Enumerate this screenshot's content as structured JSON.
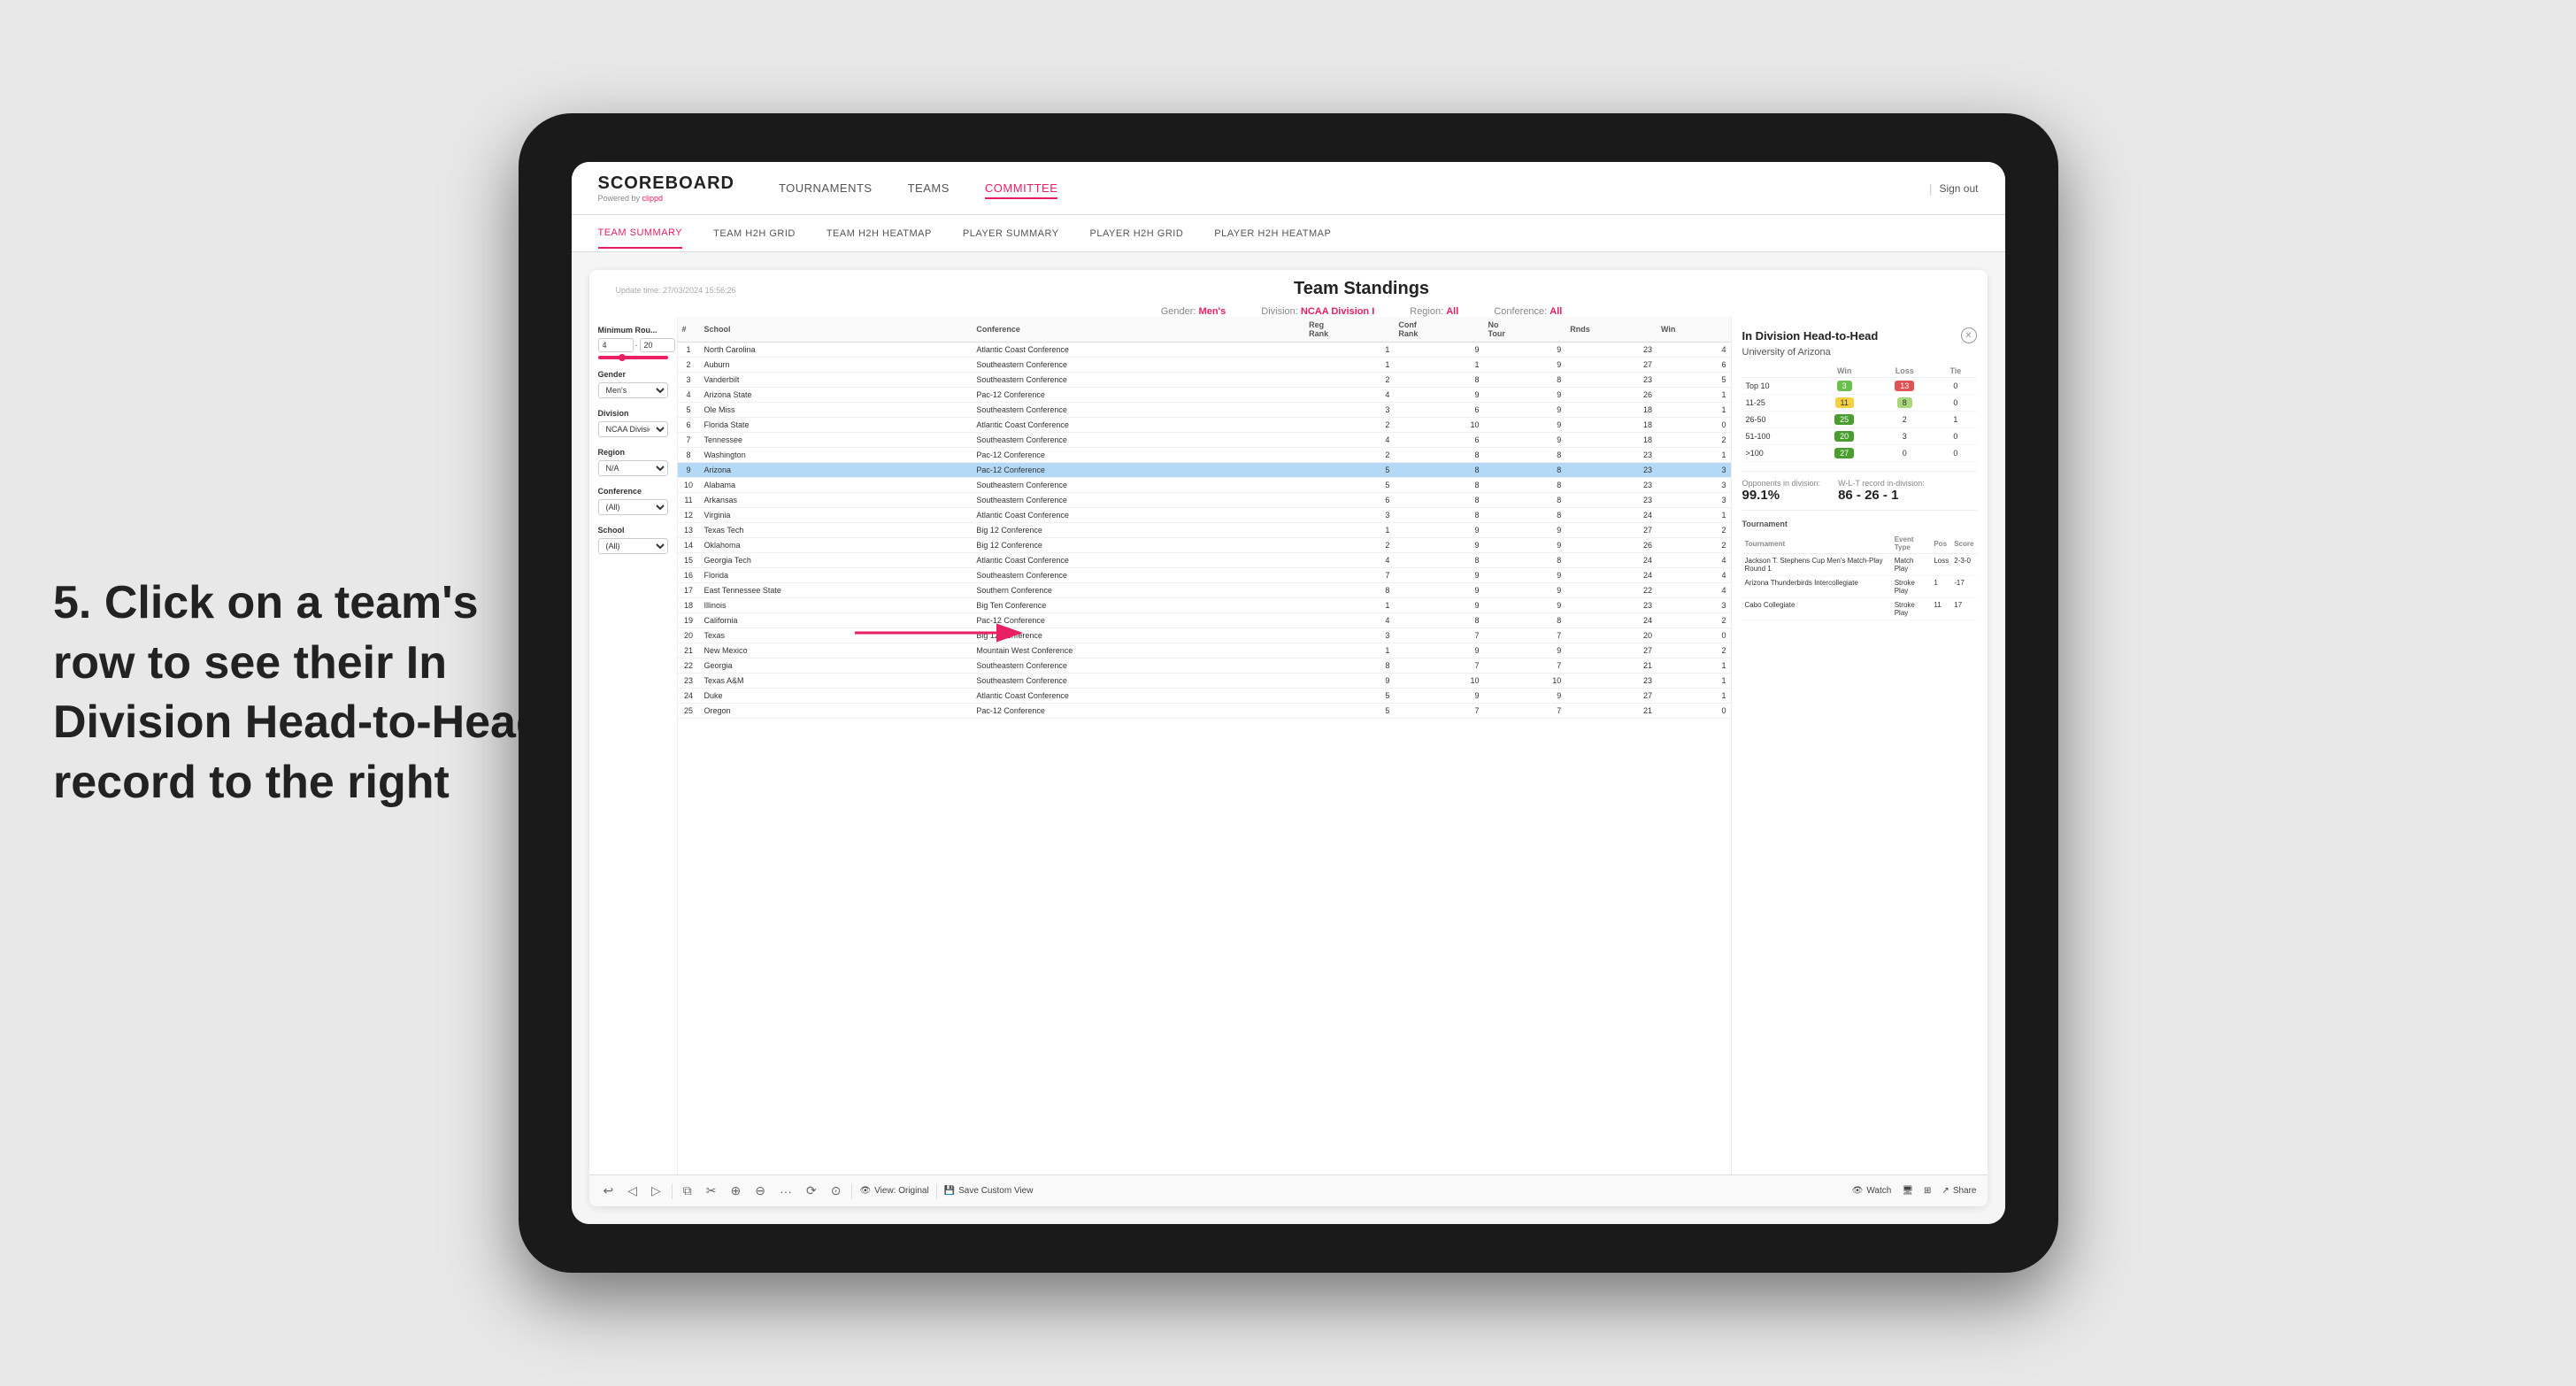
{
  "page": {
    "background": "#e8e8e8"
  },
  "annotation": {
    "text": "5. Click on a team's row to see their In Division Head-to-Head record to the right"
  },
  "top_nav": {
    "logo": "SCOREBOARD",
    "logo_sub": "Powered by clippd",
    "links": [
      {
        "label": "TOURNAMENTS",
        "active": false
      },
      {
        "label": "TEAMS",
        "active": false
      },
      {
        "label": "COMMITTEE",
        "active": true
      }
    ],
    "sign_out": "Sign out"
  },
  "sub_nav": {
    "links": [
      {
        "label": "TEAM SUMMARY",
        "active": true
      },
      {
        "label": "TEAM H2H GRID",
        "active": false
      },
      {
        "label": "TEAM H2H HEATMAP",
        "active": false
      },
      {
        "label": "PLAYER SUMMARY",
        "active": false
      },
      {
        "label": "PLAYER H2H GRID",
        "active": false
      },
      {
        "label": "PLAYER H2H HEATMAP",
        "active": false
      }
    ]
  },
  "panel": {
    "update_time": "Update time: 27/03/2024 15:56:26",
    "title": "Team Standings",
    "filters": {
      "gender_label": "Gender:",
      "gender_value": "Men's",
      "division_label": "Division:",
      "division_value": "NCAA Division I",
      "region_label": "Region:",
      "region_value": "All",
      "conference_label": "Conference:",
      "conference_value": "All"
    }
  },
  "sidebar_filters": {
    "min_rounds_label": "Minimum Rou...",
    "min_rounds_value": "4",
    "min_rounds_max": "20",
    "gender_label": "Gender",
    "gender_value": "Men's",
    "division_label": "Division",
    "division_value": "NCAA Division I",
    "region_label": "Region",
    "region_value": "N/A",
    "conference_label": "Conference",
    "conference_value": "(All)",
    "school_label": "School",
    "school_value": "(All)"
  },
  "table": {
    "headers": [
      "#",
      "School",
      "Conference",
      "Reg Rank",
      "Conf Rank",
      "No Tour",
      "Rnds",
      "Win"
    ],
    "rows": [
      {
        "rank": 1,
        "school": "North Carolina",
        "conference": "Atlantic Coast Conference",
        "reg_rank": 1,
        "conf_rank": 9,
        "no_tour": 9,
        "rnds": 23,
        "win": 4,
        "highlighted": false
      },
      {
        "rank": 2,
        "school": "Auburn",
        "conference": "Southeastern Conference",
        "reg_rank": 1,
        "conf_rank": 1,
        "no_tour": 9,
        "rnds": 27,
        "win": 6,
        "highlighted": false
      },
      {
        "rank": 3,
        "school": "Vanderbilt",
        "conference": "Southeastern Conference",
        "reg_rank": 2,
        "conf_rank": 8,
        "no_tour": 8,
        "rnds": 23,
        "win": 5,
        "highlighted": false
      },
      {
        "rank": 4,
        "school": "Arizona State",
        "conference": "Pac-12 Conference",
        "reg_rank": 4,
        "conf_rank": 9,
        "no_tour": 9,
        "rnds": 26,
        "win": 1,
        "highlighted": false
      },
      {
        "rank": 5,
        "school": "Ole Miss",
        "conference": "Southeastern Conference",
        "reg_rank": 3,
        "conf_rank": 6,
        "no_tour": 9,
        "rnds": 18,
        "win": 1,
        "highlighted": false
      },
      {
        "rank": 6,
        "school": "Florida State",
        "conference": "Atlantic Coast Conference",
        "reg_rank": 2,
        "conf_rank": 10,
        "no_tour": 9,
        "rnds": 18,
        "win": 0,
        "highlighted": false
      },
      {
        "rank": 7,
        "school": "Tennessee",
        "conference": "Southeastern Conference",
        "reg_rank": 4,
        "conf_rank": 6,
        "no_tour": 9,
        "rnds": 18,
        "win": 2,
        "highlighted": false
      },
      {
        "rank": 8,
        "school": "Washington",
        "conference": "Pac-12 Conference",
        "reg_rank": 2,
        "conf_rank": 8,
        "no_tour": 8,
        "rnds": 23,
        "win": 1,
        "highlighted": false
      },
      {
        "rank": 9,
        "school": "Arizona",
        "conference": "Pac-12 Conference",
        "reg_rank": 5,
        "conf_rank": 8,
        "no_tour": 8,
        "rnds": 23,
        "win": 3,
        "highlighted": true
      },
      {
        "rank": 10,
        "school": "Alabama",
        "conference": "Southeastern Conference",
        "reg_rank": 5,
        "conf_rank": 8,
        "no_tour": 8,
        "rnds": 23,
        "win": 3,
        "highlighted": false
      },
      {
        "rank": 11,
        "school": "Arkansas",
        "conference": "Southeastern Conference",
        "reg_rank": 6,
        "conf_rank": 8,
        "no_tour": 8,
        "rnds": 23,
        "win": 3,
        "highlighted": false
      },
      {
        "rank": 12,
        "school": "Virginia",
        "conference": "Atlantic Coast Conference",
        "reg_rank": 3,
        "conf_rank": 8,
        "no_tour": 8,
        "rnds": 24,
        "win": 1,
        "highlighted": false
      },
      {
        "rank": 13,
        "school": "Texas Tech",
        "conference": "Big 12 Conference",
        "reg_rank": 1,
        "conf_rank": 9,
        "no_tour": 9,
        "rnds": 27,
        "win": 2,
        "highlighted": false
      },
      {
        "rank": 14,
        "school": "Oklahoma",
        "conference": "Big 12 Conference",
        "reg_rank": 2,
        "conf_rank": 9,
        "no_tour": 9,
        "rnds": 26,
        "win": 2,
        "highlighted": false
      },
      {
        "rank": 15,
        "school": "Georgia Tech",
        "conference": "Atlantic Coast Conference",
        "reg_rank": 4,
        "conf_rank": 8,
        "no_tour": 8,
        "rnds": 24,
        "win": 4,
        "highlighted": false
      },
      {
        "rank": 16,
        "school": "Florida",
        "conference": "Southeastern Conference",
        "reg_rank": 7,
        "conf_rank": 9,
        "no_tour": 9,
        "rnds": 24,
        "win": 4,
        "highlighted": false
      },
      {
        "rank": 17,
        "school": "East Tennessee State",
        "conference": "Southern Conference",
        "reg_rank": 8,
        "conf_rank": 9,
        "no_tour": 9,
        "rnds": 22,
        "win": 4,
        "highlighted": false
      },
      {
        "rank": 18,
        "school": "Illinois",
        "conference": "Big Ten Conference",
        "reg_rank": 1,
        "conf_rank": 9,
        "no_tour": 9,
        "rnds": 23,
        "win": 3,
        "highlighted": false
      },
      {
        "rank": 19,
        "school": "California",
        "conference": "Pac-12 Conference",
        "reg_rank": 4,
        "conf_rank": 8,
        "no_tour": 8,
        "rnds": 24,
        "win": 2,
        "highlighted": false
      },
      {
        "rank": 20,
        "school": "Texas",
        "conference": "Big 12 Conference",
        "reg_rank": 3,
        "conf_rank": 7,
        "no_tour": 7,
        "rnds": 20,
        "win": 0,
        "highlighted": false
      },
      {
        "rank": 21,
        "school": "New Mexico",
        "conference": "Mountain West Conference",
        "reg_rank": 1,
        "conf_rank": 9,
        "no_tour": 9,
        "rnds": 27,
        "win": 2,
        "highlighted": false
      },
      {
        "rank": 22,
        "school": "Georgia",
        "conference": "Southeastern Conference",
        "reg_rank": 8,
        "conf_rank": 7,
        "no_tour": 7,
        "rnds": 21,
        "win": 1,
        "highlighted": false
      },
      {
        "rank": 23,
        "school": "Texas A&M",
        "conference": "Southeastern Conference",
        "reg_rank": 9,
        "conf_rank": 10,
        "no_tour": 10,
        "rnds": 23,
        "win": 1,
        "highlighted": false
      },
      {
        "rank": 24,
        "school": "Duke",
        "conference": "Atlantic Coast Conference",
        "reg_rank": 5,
        "conf_rank": 9,
        "no_tour": 9,
        "rnds": 27,
        "win": 1,
        "highlighted": false
      },
      {
        "rank": 25,
        "school": "Oregon",
        "conference": "Pac-12 Conference",
        "reg_rank": 5,
        "conf_rank": 7,
        "no_tour": 7,
        "rnds": 21,
        "win": 0,
        "highlighted": false
      }
    ]
  },
  "h2h_panel": {
    "title": "In Division Head-to-Head",
    "subtitle": "University of Arizona",
    "table_headers": [
      "",
      "Win",
      "Loss",
      "Tie"
    ],
    "rows": [
      {
        "range": "Top 10",
        "win": 3,
        "loss": 13,
        "tie": 0,
        "win_color": "green",
        "loss_color": "red",
        "tie_color": "none"
      },
      {
        "range": "11-25",
        "win": 11,
        "loss": 8,
        "tie": 0,
        "win_color": "yellow",
        "loss_color": "light-green",
        "tie_color": "none"
      },
      {
        "range": "26-50",
        "win": 25,
        "loss": 2,
        "tie": 1,
        "win_color": "dark-green",
        "loss_color": "none",
        "tie_color": "none"
      },
      {
        "range": "51-100",
        "win": 20,
        "loss": 3,
        "tie": 0,
        "win_color": "dark-green",
        "loss_color": "none",
        "tie_color": "none"
      },
      {
        "range": ">100",
        "win": 27,
        "loss": 0,
        "tie": 0,
        "win_color": "dark-green",
        "loss_color": "none",
        "tie_color": "none"
      }
    ],
    "opponents_label": "Opponents in division:",
    "opponents_value": "99.1%",
    "record_label": "W-L-T record in-division:",
    "record_value": "86 - 26 - 1",
    "tournament_label": "Tournament",
    "tournament_headers": [
      "Tournament",
      "Event Type",
      "Pos",
      "Score"
    ],
    "tournaments": [
      {
        "name": "Jackson T. Stephens Cup Men's Match-Play Round",
        "event_type": "Match Play",
        "pos": "Loss",
        "score": "2-3-0"
      },
      {
        "name": "Arizona Thunderbirds Intercollegiate",
        "event_type": "Stroke Play",
        "pos": "1",
        "score": "-17"
      },
      {
        "name": "Cabo Collegiate",
        "event_type": "Stroke Play",
        "pos": "11",
        "score": "17"
      }
    ]
  },
  "toolbar": {
    "buttons": [
      "↩",
      "←",
      "→",
      "⧉",
      "✂",
      "⊕",
      "⊖",
      "·",
      "⟳",
      "⊙"
    ],
    "view_original": "View: Original",
    "save_custom": "Save Custom View",
    "watch": "Watch",
    "share": "Share"
  }
}
